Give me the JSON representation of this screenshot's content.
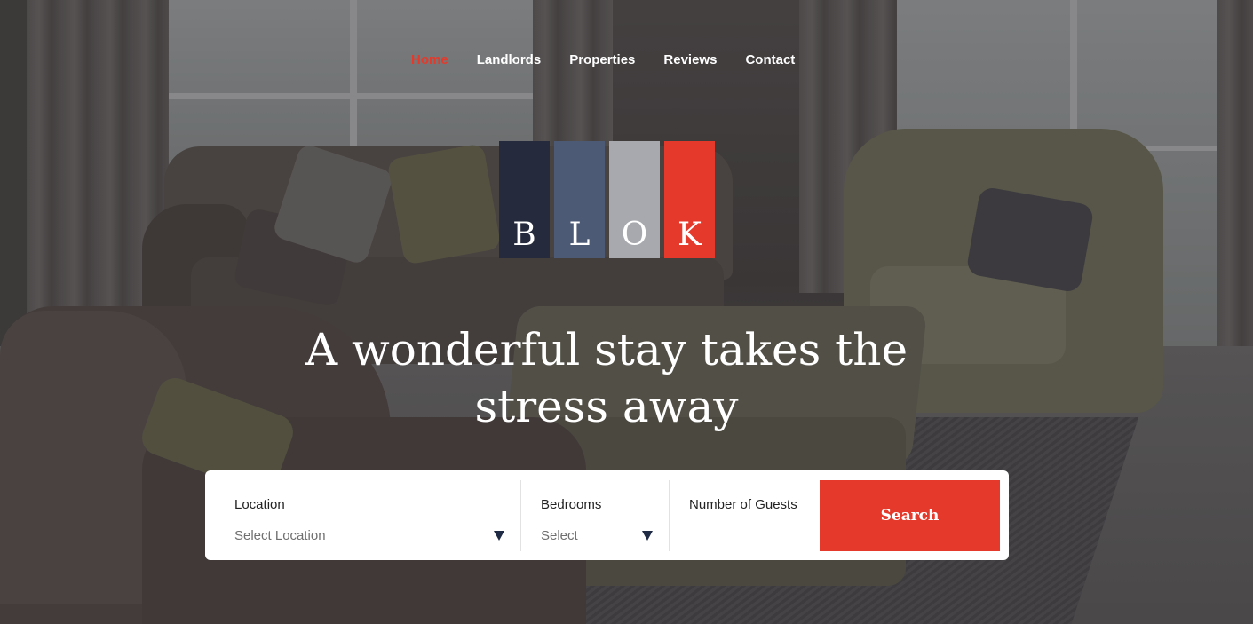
{
  "nav": {
    "items": [
      {
        "label": "Home",
        "active": true
      },
      {
        "label": "Landlords",
        "active": false
      },
      {
        "label": "Properties",
        "active": false
      },
      {
        "label": "Reviews",
        "active": false
      },
      {
        "label": "Contact",
        "active": false
      }
    ]
  },
  "logo": {
    "letters": [
      "B",
      "L",
      "O",
      "K"
    ],
    "colors": [
      "#262a3d",
      "#4d5a76",
      "#a7a9ae",
      "#e53a2b"
    ]
  },
  "hero": {
    "headline_line1": "A wonderful stay takes the",
    "headline_line2": "stress away"
  },
  "search": {
    "location_label": "Location",
    "location_value": "Select Location",
    "bedrooms_label": "Bedrooms",
    "bedrooms_value": "Select",
    "guests_label": "Number of Guests",
    "button_label": "Search"
  },
  "colors": {
    "accent": "#e53a2b",
    "caret": "#1f2a44"
  }
}
